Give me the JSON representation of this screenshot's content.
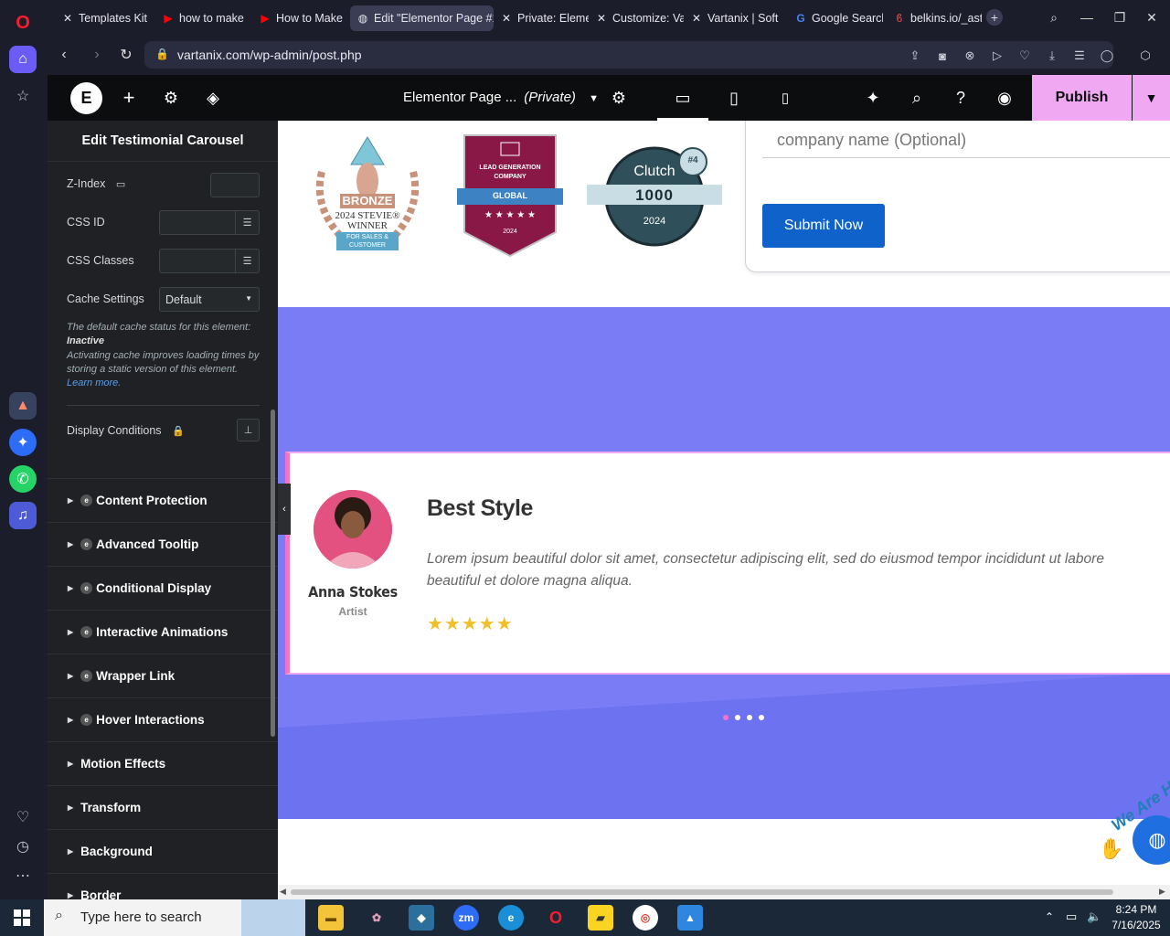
{
  "browser": {
    "tabs": [
      {
        "label": "Templates Kit",
        "icon": "elementor-x-icon",
        "active": false
      },
      {
        "label": "how to make",
        "icon": "youtube-icon",
        "active": false
      },
      {
        "label": "How to Make",
        "icon": "youtube-icon",
        "active": false
      },
      {
        "label": "Edit \"Elementor Page #1",
        "icon": "globe-icon",
        "active": true
      },
      {
        "label": "Private: Eleme",
        "icon": "elementor-x-icon",
        "active": false
      },
      {
        "label": "Customize: Va",
        "icon": "elementor-x-icon",
        "active": false
      },
      {
        "label": "Vartanix | Soft",
        "icon": "elementor-x-icon",
        "active": false
      },
      {
        "label": "Google Search",
        "icon": "google-icon",
        "active": false
      },
      {
        "label": "belkins.io/_ast",
        "icon": "belkins-icon",
        "active": false
      }
    ],
    "url": "vartanix.com/wp-admin/post.php"
  },
  "editor": {
    "page_title": "Elementor Page ...",
    "page_status": "(Private)",
    "publish_label": "Publish",
    "active_device": "desktop"
  },
  "panel": {
    "title": "Edit Testimonial Carousel",
    "zindex_label": "Z-Index",
    "cssid_label": "CSS ID",
    "cssclasses_label": "CSS Classes",
    "cache_label": "Cache Settings",
    "cache_value": "Default",
    "cache_note_1": "The default cache status for this element:",
    "cache_note_status": "Inactive",
    "cache_note_2": "Activating cache improves loading times by storing a static version of this element.",
    "cache_note_link": "Learn more.",
    "display_conditions_label": "Display Conditions",
    "sections": [
      {
        "label": "Content Protection",
        "ext": true
      },
      {
        "label": "Advanced Tooltip",
        "ext": true
      },
      {
        "label": "Conditional Display",
        "ext": true
      },
      {
        "label": "Interactive Animations",
        "ext": true
      },
      {
        "label": "Wrapper Link",
        "ext": true
      },
      {
        "label": "Hover Interactions",
        "ext": true
      },
      {
        "label": "Motion Effects",
        "ext": false
      },
      {
        "label": "Transform",
        "ext": false
      },
      {
        "label": "Background",
        "ext": false
      },
      {
        "label": "Border",
        "ext": false
      }
    ]
  },
  "canvas": {
    "badge_stevie": {
      "l1": "BRONZE",
      "l2": "2024 STEVIE®",
      "l3": "WINNER",
      "l4": "FOR SALES &",
      "l5": "CUSTOMER SERVICE"
    },
    "badge_leadgen": {
      "l1": "LEAD GENERATION",
      "l2": "COMPANY",
      "l3": "GLOBAL",
      "l4": "★ ★ ★ ★ ★",
      "l5": "2024"
    },
    "badge_clutch": {
      "l1": "Clutch",
      "l2": "1000",
      "l3": "2024",
      "rank": "#4"
    },
    "form": {
      "company_placeholder": "company name (Optional)",
      "submit_label": "Submit Now"
    },
    "testimonial": {
      "title": "Best Style",
      "text": "Lorem ipsum beautiful dolor sit amet, consectetur adipiscing elit, sed do eiusmod tempor incididunt ut labore beautiful et dolore magna aliqua.",
      "name": "Anna Stokes",
      "role": "Artist",
      "stars": "★★★★★",
      "rating": 5,
      "slide_count": 4,
      "active_slide": 0
    },
    "floating_text": "We Are H"
  },
  "taskbar": {
    "search_placeholder": "Type here to search",
    "time": "8:24 PM",
    "date": "7/16/2025"
  },
  "colors": {
    "accent": "#f0a8f2",
    "canvas_purple": "#7a7cf6",
    "submit_blue": "#0f62c9",
    "editor_dark": "#0c0d0e",
    "panel_bg": "#1f2124"
  }
}
